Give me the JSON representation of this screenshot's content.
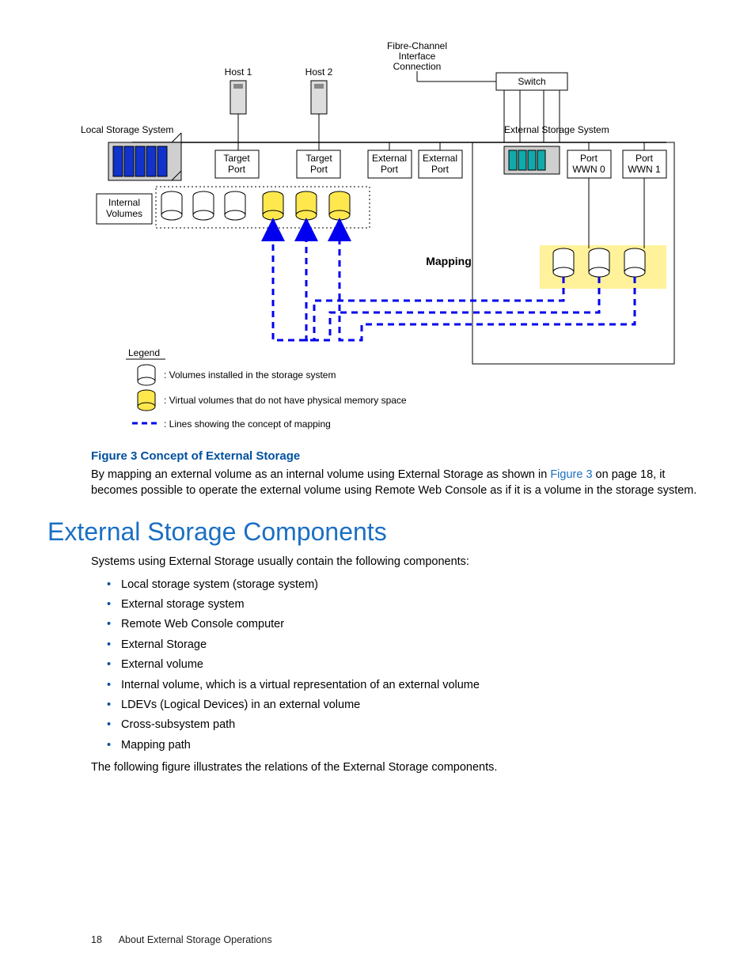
{
  "diagram": {
    "labels": {
      "host1": "Host 1",
      "host2": "Host 2",
      "fibre": "Fibre-Channel\nInterface\nConnection",
      "switch": "Switch",
      "localSys": "Local Storage System",
      "extSys": "External Storage System",
      "targetPort1": "Target\nPort",
      "targetPort2": "Target\nPort",
      "extPort1": "External\nPort",
      "extPort2": "External\nPort",
      "wwn0": "Port\nWWN 0",
      "wwn1": "Port\nWWN 1",
      "internalVolumes": "Internal\nVolumes",
      "mapping": "Mapping",
      "legend": "Legend",
      "legendVol": ": Volumes installed in the storage system",
      "legendVirt": ": Virtual volumes that do not have physical memory space",
      "legendLines": ": Lines showing the concept of mapping"
    }
  },
  "caption": "Figure 3 Concept of External Storage",
  "para1_a": "By mapping an external volume as an internal volume using External Storage as shown in ",
  "para1_link": "Figure 3",
  "para1_b": " on page 18, it becomes possible to operate the external volume using Remote Web Console as if it is a volume in the storage system.",
  "heading": "External Storage Components",
  "para2": "Systems using External Storage usually contain the following components:",
  "bullets": [
    "Local storage system (storage system)",
    "External storage system",
    "Remote Web Console computer",
    "External Storage",
    "External volume",
    "Internal volume, which is a virtual representation of an external volume",
    "LDEVs (Logical Devices) in an external volume",
    "Cross-subsystem path",
    "Mapping path"
  ],
  "para3": "The following figure illustrates the relations of the External Storage components.",
  "footer": {
    "page": "18",
    "section": "About External Storage Operations"
  }
}
